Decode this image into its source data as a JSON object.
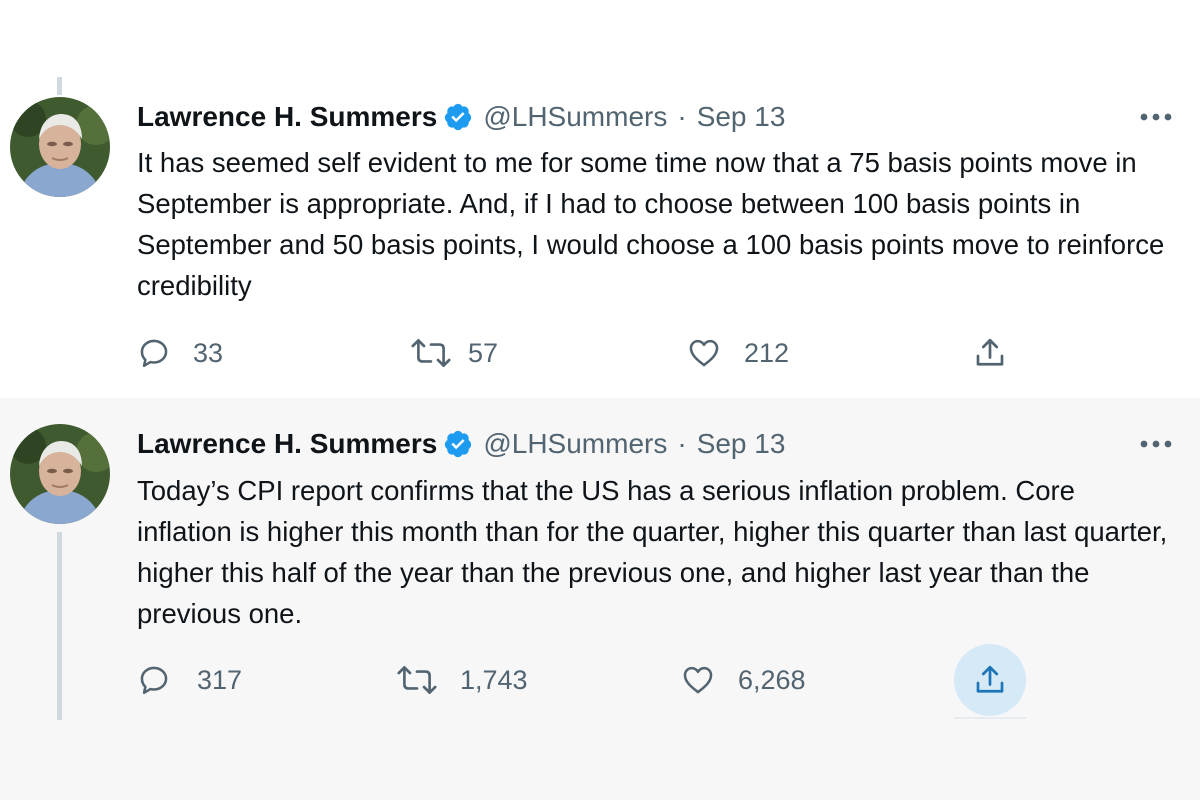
{
  "tweets": [
    {
      "author": "Lawrence H. Summers",
      "handle": "@LHSummers",
      "sep": "·",
      "date": "Sep 13",
      "text": "It has seemed self evident to me for some time now that a 75 basis points move in September is appropriate. And, if I had to choose between 100 basis points in September and 50 basis points, I would choose a 100 basis points move to reinforce credibility",
      "replies": "33",
      "retweets": "57",
      "likes": "212"
    },
    {
      "author": "Lawrence H. Summers",
      "handle": "@LHSummers",
      "sep": "·",
      "date": "Sep 13",
      "text": "Today’s CPI report confirms that the US has a serious inflation problem. Core inflation is higher this month than for the quarter, higher this quarter than last quarter, higher this half of the year than the previous one, and higher last year than the previous one.",
      "replies": "317",
      "retweets": "1,743",
      "likes": "6,268"
    }
  ],
  "icons": {
    "verified": "verified-badge-icon",
    "more": "more-icon",
    "reply": "reply-icon",
    "retweet": "retweet-icon",
    "like": "heart-icon",
    "share": "share-icon"
  },
  "colors": {
    "verified": "#1d9bf0",
    "secondary_text": "#536471",
    "thread_line": "#cfd9de",
    "share_highlight": "#d6e9f7"
  }
}
